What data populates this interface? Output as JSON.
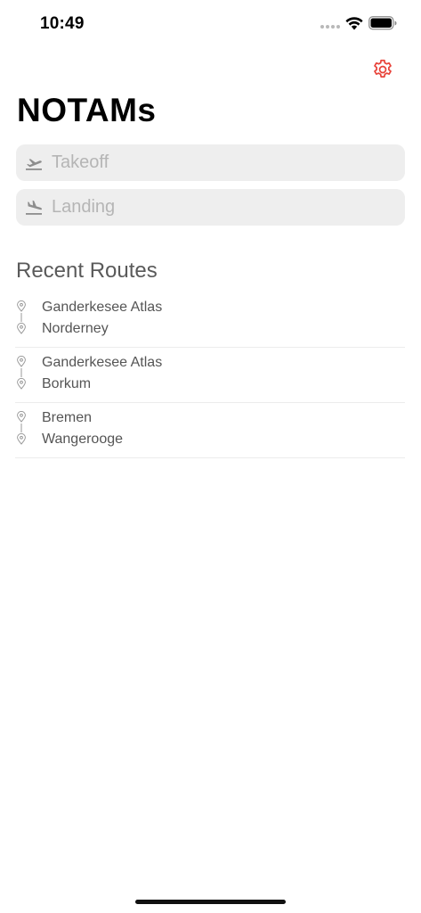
{
  "status_bar": {
    "time": "10:49"
  },
  "header": {
    "title": "NOTAMs",
    "settings_icon": "gear-icon",
    "accent_color": "#e8433a"
  },
  "search": {
    "takeoff_placeholder": "Takeoff",
    "takeoff_value": "",
    "takeoff_icon": "flight-takeoff-icon",
    "landing_placeholder": "Landing",
    "landing_value": "",
    "landing_icon": "flight-landing-icon"
  },
  "recent": {
    "title": "Recent Routes",
    "routes": [
      {
        "from": "Ganderkesee Atlas",
        "to": "Norderney"
      },
      {
        "from": "Ganderkesee Atlas",
        "to": "Borkum"
      },
      {
        "from": "Bremen",
        "to": "Wangerooge"
      }
    ]
  }
}
